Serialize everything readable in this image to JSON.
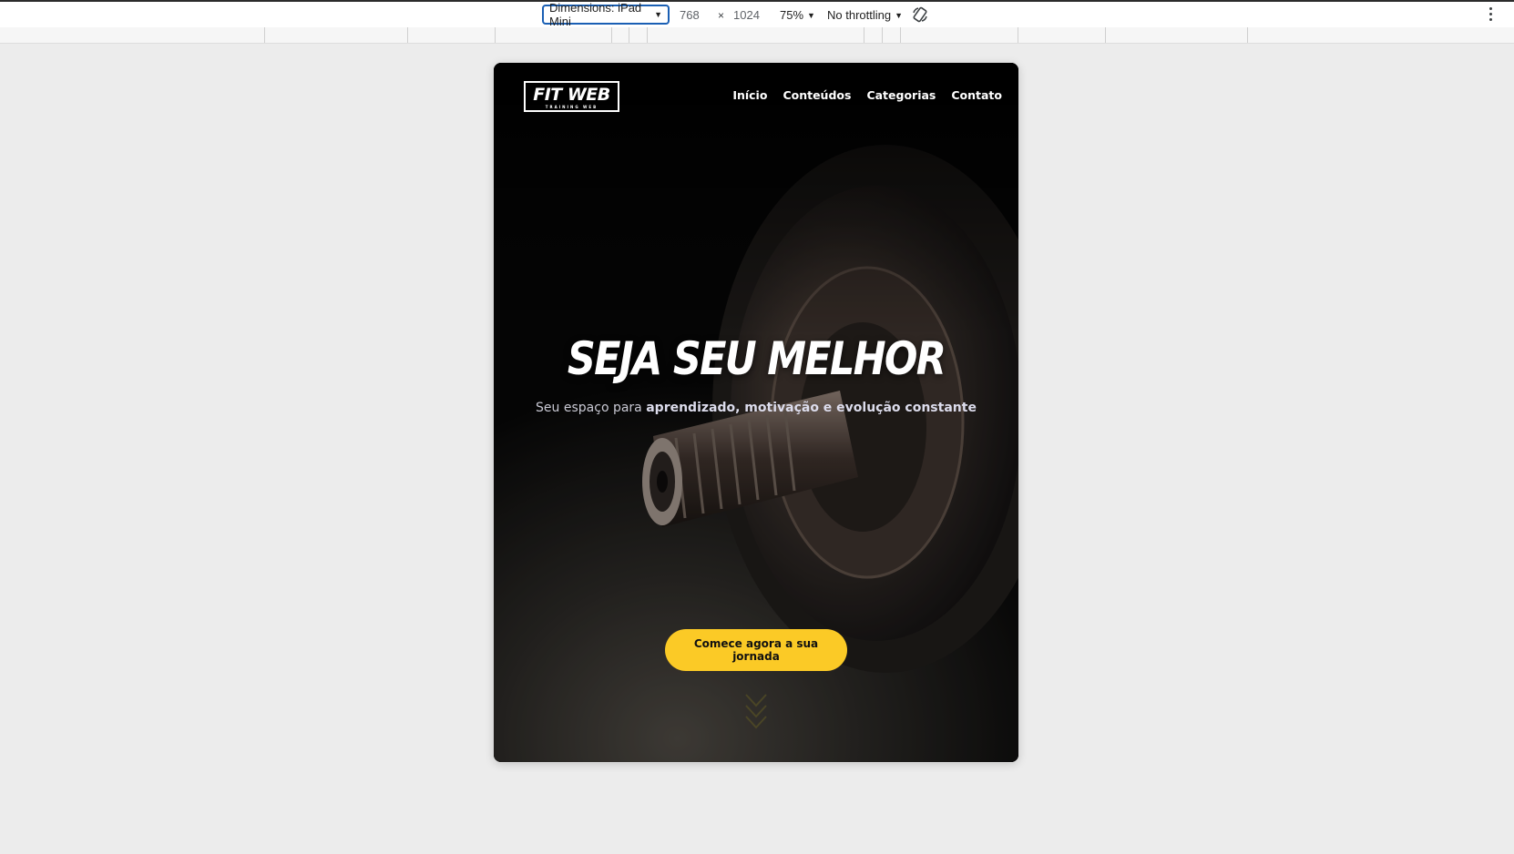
{
  "devtools": {
    "dimensions_label": "Dimensions: iPad Mini",
    "width": "768",
    "times": "×",
    "height": "1024",
    "zoom": "75%",
    "throttling": "No throttling"
  },
  "site": {
    "logo_text": "FIT WEB",
    "logo_subtext": "TRAINING WEB",
    "nav": [
      "Início",
      "Conteúdos",
      "Categorias",
      "Contato"
    ],
    "hero": {
      "title": "SEJA SEU MELHOR",
      "subtitle_plain": "Seu espaço para ",
      "subtitle_bold": "aprendizado, motivação e evolução constante",
      "cta_label": "Comece agora a sua jornada"
    }
  },
  "colors": {
    "accent": "#fbca26",
    "devtools_focus": "#1a5fb4"
  },
  "icons": [
    "caret-down-icon",
    "rotate-icon",
    "more-options-icon",
    "scroll-down-chevron-icon"
  ]
}
